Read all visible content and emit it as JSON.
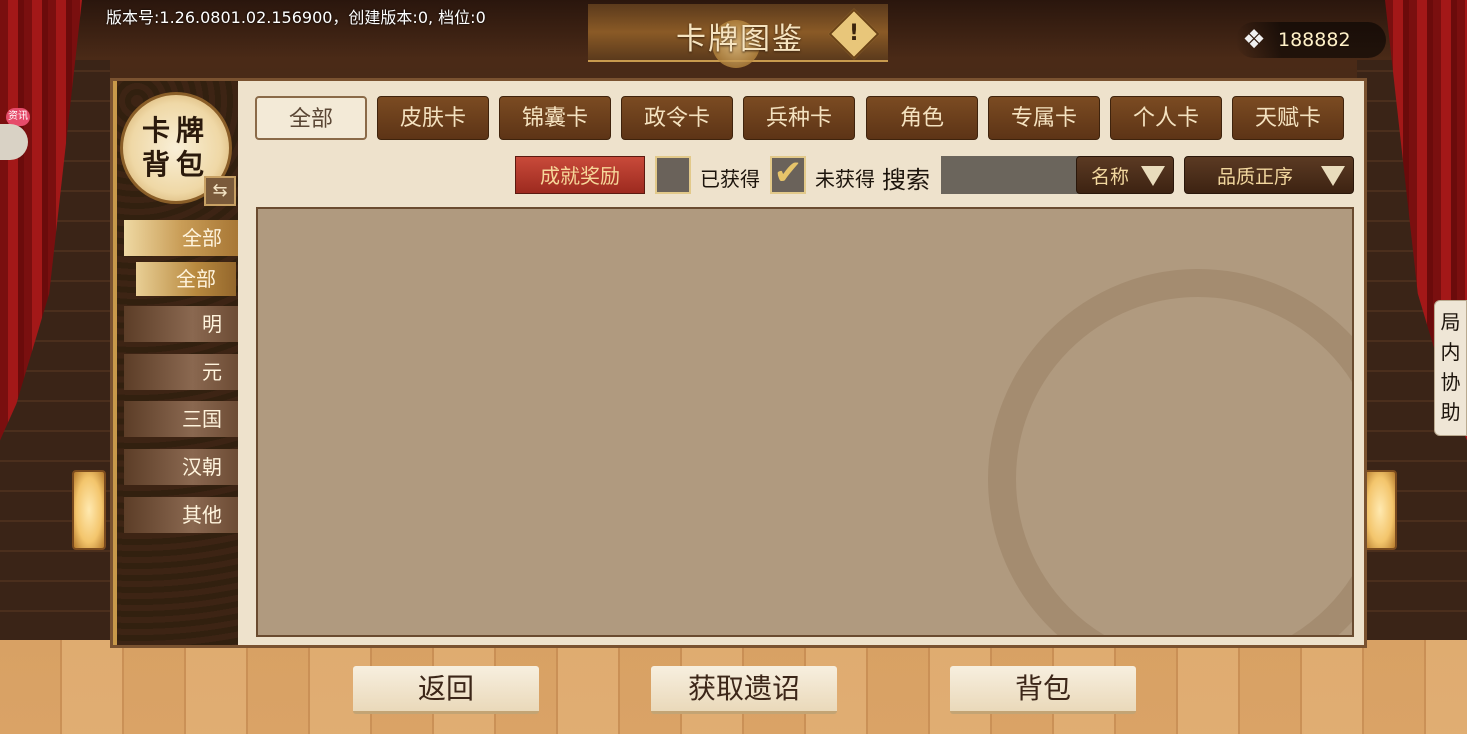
{
  "version_text": "版本号:1.26.0801.02.156900，创建版本:0, 档位:0",
  "title": "卡牌图鉴",
  "info_icon": "!",
  "currency": {
    "icon": "fan-icon",
    "value": "188882"
  },
  "sidebar": {
    "emblem_text": "卡牌背包",
    "swap_icon": "⇆",
    "items": [
      {
        "label": "全部",
        "active": true
      },
      {
        "label": "全部",
        "sub": true
      },
      {
        "label": "明"
      },
      {
        "label": "元"
      },
      {
        "label": "三国"
      },
      {
        "label": "汉朝"
      },
      {
        "label": "其他"
      }
    ]
  },
  "tabs": [
    {
      "label": "全部",
      "active": true
    },
    {
      "label": "皮肤卡"
    },
    {
      "label": "锦囊卡"
    },
    {
      "label": "政令卡"
    },
    {
      "label": "兵种卡"
    },
    {
      "label": "角色"
    },
    {
      "label": "专属卡"
    },
    {
      "label": "个人卡"
    },
    {
      "label": "天赋卡"
    }
  ],
  "filters": {
    "achievement_label": "成就奖励",
    "obtained_label": "已获得",
    "obtained_checked": false,
    "unobtained_label": "未获得",
    "unobtained_checked": true,
    "check_mark": "✔",
    "search_label": "搜索",
    "search_value": "",
    "name_dropdown": "名称",
    "sort_dropdown": "品质正序"
  },
  "bottom_buttons": {
    "back": "返回",
    "get_edict": "获取遗诏",
    "backpack": "背包"
  },
  "news_badge": "资讯",
  "assist_tab": [
    "局",
    "内",
    "协",
    "助"
  ],
  "colors": {
    "tab_bg": "#6d4020",
    "tab_text": "#f4e2c0",
    "achievement_bg": "#b8392b",
    "content_bg": "#b09a7f"
  }
}
